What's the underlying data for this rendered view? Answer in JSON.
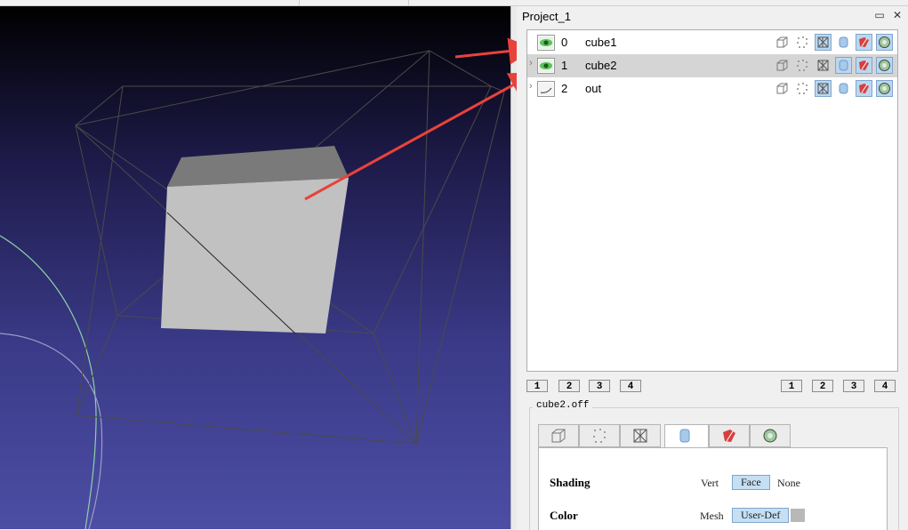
{
  "panel": {
    "title": "Project_1",
    "restore_icon": "restore-icon",
    "close_icon": "close-icon"
  },
  "layers": [
    {
      "id": "0",
      "name": "cube1",
      "expander": "",
      "thumb": "eye-icon",
      "selected": false
    },
    {
      "id": "1",
      "name": "cube2",
      "expander": "›",
      "thumb": "eye-icon",
      "selected": true
    },
    {
      "id": "2",
      "name": "out",
      "expander": "›",
      "thumb": "curve-thumb-icon",
      "selected": false
    }
  ],
  "row_icons": [
    "box-icon",
    "points-icon",
    "wireframe-icon",
    "cylinder-icon",
    "red-shape-icon",
    "texture-icon"
  ],
  "numbers_left": [
    "1",
    "2",
    "3",
    "4"
  ],
  "numbers_right": [
    "1",
    "2",
    "3",
    "4"
  ],
  "info": {
    "file_label": "cube2.off",
    "tabs": [
      "box-icon",
      "points-icon",
      "wireframe-icon",
      "cylinder-icon",
      "red-shape-icon",
      "texture-icon"
    ],
    "active_tab": 3,
    "shading": {
      "label": "Shading",
      "options": [
        "Vert",
        "Face",
        "None"
      ],
      "selected": "Face"
    },
    "color": {
      "label": "Color",
      "options": [
        "Mesh",
        "User-Def"
      ],
      "selected": "User-Def"
    }
  },
  "colors": {
    "accent": "#bcd7f0",
    "selected_row": "#d5d5d5",
    "arrow": "#e8423c",
    "cube_face": "#c1c1c1"
  }
}
